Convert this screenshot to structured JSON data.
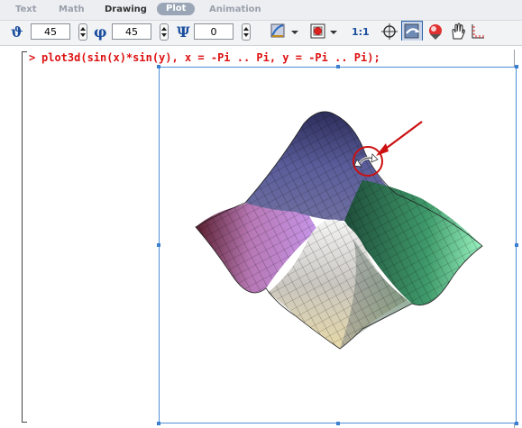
{
  "tabs": [
    {
      "label": "Text",
      "state": "normal"
    },
    {
      "label": "Math",
      "state": "normal"
    },
    {
      "label": "Drawing",
      "state": "bold"
    },
    {
      "label": "Plot",
      "state": "active"
    },
    {
      "label": "Animation",
      "state": "normal"
    }
  ],
  "toolbar": {
    "theta": {
      "symbol": "ϑ",
      "value": "45"
    },
    "phi": {
      "symbol": "φ",
      "value": "45"
    },
    "psi": {
      "symbol": "Ψ",
      "value": "0"
    },
    "scale_label": "1:1"
  },
  "worksheet": {
    "prompt": ">",
    "command": "plot3d(sin(x)*sin(y), x = -Pi .. Pi, y = -Pi .. Pi);"
  },
  "colors": {
    "command_text": "#dd1111",
    "selection_border": "#4f8fd8",
    "annotation_red": "#cc1010",
    "angle_icon": "#1a4e9e"
  },
  "icons": [
    "axes-style-icon",
    "shading-style-icon",
    "scale-constrained-icon",
    "pointer-target-icon",
    "rotate-icon",
    "pan-icon",
    "zoom-icon",
    "hand-icon",
    "axes-extent-icon"
  ]
}
